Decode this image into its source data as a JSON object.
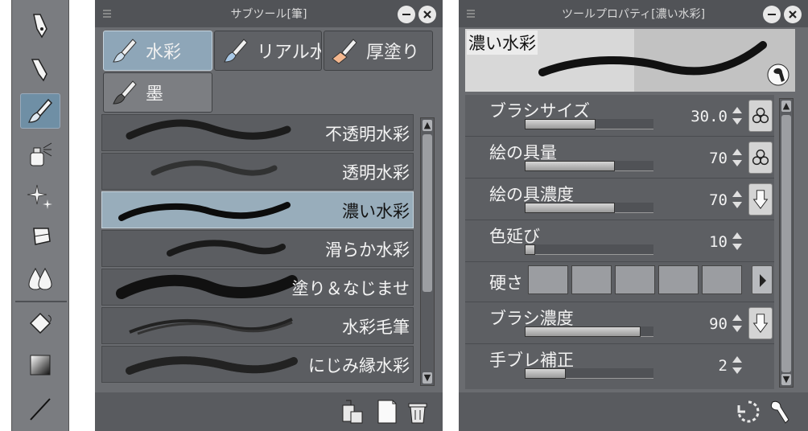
{
  "toolbar": {
    "tools": [
      {
        "name": "pen-icon"
      },
      {
        "name": "pencil-icon"
      },
      {
        "name": "brush-icon",
        "selected": true
      },
      {
        "name": "airbrush-icon"
      },
      {
        "name": "decoration-icon"
      },
      {
        "name": "eraser-icon"
      },
      {
        "name": "blend-icon"
      },
      {
        "name": "fill-icon"
      },
      {
        "name": "gradient-icon"
      },
      {
        "name": "figure-icon"
      }
    ]
  },
  "subtool": {
    "title": "サブツール[筆]",
    "tabs": [
      "水彩",
      "リアル水",
      "厚塗り",
      "墨"
    ],
    "brushes": [
      "不透明水彩",
      "透明水彩",
      "濃い水彩",
      "滑らか水彩",
      "塗り＆なじませ",
      "水彩毛筆",
      "にじみ縁水彩"
    ],
    "selected_brush": "濃い水彩"
  },
  "toolprop": {
    "title": "ツールプロパティ[濃い水彩]",
    "preview_label": "濃い水彩",
    "props": [
      {
        "label": "ブラシサイズ",
        "value": "30.0",
        "fill": 0.55
      },
      {
        "label": "絵の具量",
        "value": "70",
        "fill": 0.7
      },
      {
        "label": "絵の具濃度",
        "value": "70",
        "fill": 0.7
      },
      {
        "label": "色延び",
        "value": "10",
        "fill": 0.08
      },
      {
        "label": "硬さ",
        "value": ""
      },
      {
        "label": "ブラシ濃度",
        "value": "90",
        "fill": 0.9
      },
      {
        "label": "手ブレ補正",
        "value": "2",
        "fill": 0.32
      }
    ]
  },
  "colors": {
    "panel_bg": "#6a6c70",
    "titlebar": "#515357",
    "selected": "#98adbb"
  }
}
